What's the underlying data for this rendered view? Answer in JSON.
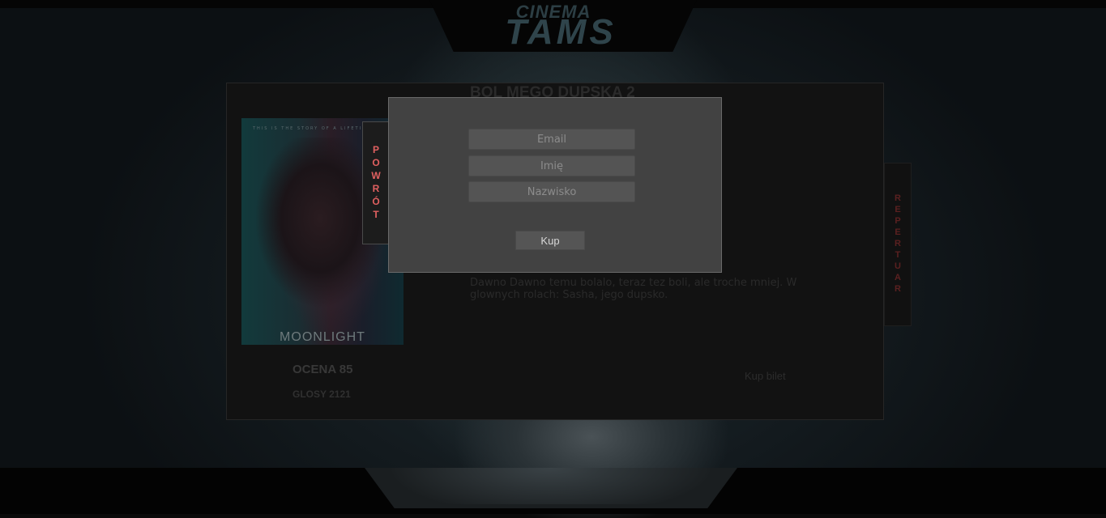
{
  "header": {
    "logo_top": "CINEMA",
    "logo_bottom": "TAMS"
  },
  "movie": {
    "title": "BOL MEGO DUPSKA 2",
    "poster_title": "MOONLIGHT",
    "poster_tagline": "THIS IS THE STORY OF A LIFETIME",
    "rating": "OCENA 85",
    "votes": "GLOSY 2121",
    "description": "Dawno Dawno temu bolalo, teraz tez boli, ale troche mniej. W glownych rolach: Sasha, jego dupsko.",
    "buy_ticket": "Kup bilet"
  },
  "nav": {
    "back_label": "POWRÓT",
    "repertoire_label": "REPERTUAR"
  },
  "modal": {
    "email_placeholder": "Email",
    "name_placeholder": "Imię",
    "surname_placeholder": "Nazwisko",
    "submit_label": "Kup"
  },
  "colors": {
    "accent_red": "#e06060",
    "modal_bg": "#424242",
    "panel_bg": "#121212"
  }
}
